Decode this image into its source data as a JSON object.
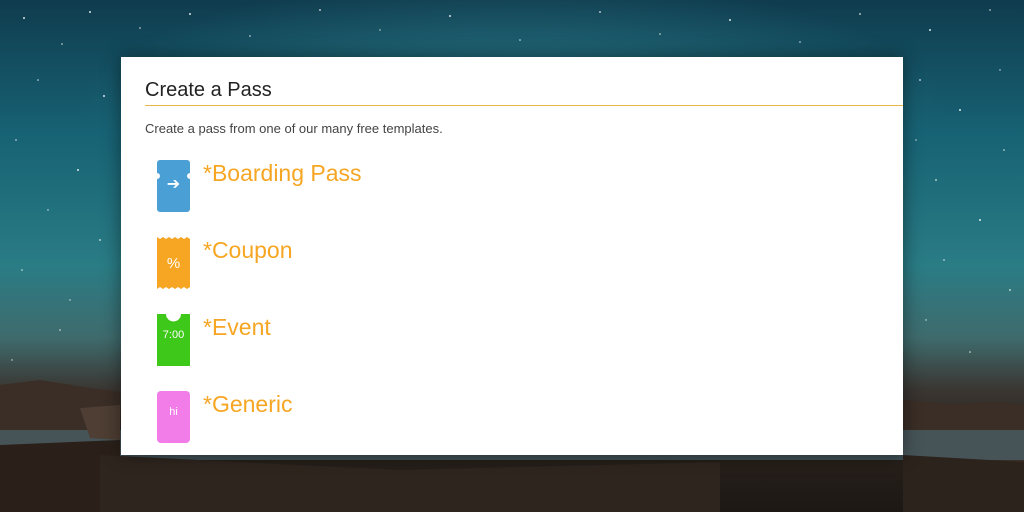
{
  "dialog": {
    "title": "Create a Pass",
    "subtitle": "Create a pass from one of our many free templates."
  },
  "templates": [
    {
      "label": "*Boarding Pass",
      "icon": "boarding-pass-icon",
      "glyph": "➔",
      "color": "#4a9fd5"
    },
    {
      "label": "*Coupon",
      "icon": "coupon-icon",
      "glyph": "%",
      "color": "#f6a623"
    },
    {
      "label": "*Event",
      "icon": "event-ticket-icon",
      "glyph": "7:00",
      "color": "#3ec81a"
    },
    {
      "label": "*Generic",
      "icon": "generic-pass-icon",
      "glyph": "hi",
      "color": "#f27de8"
    }
  ],
  "colors": {
    "accent": "#f6a623",
    "header_rule": "#e8b64a"
  }
}
